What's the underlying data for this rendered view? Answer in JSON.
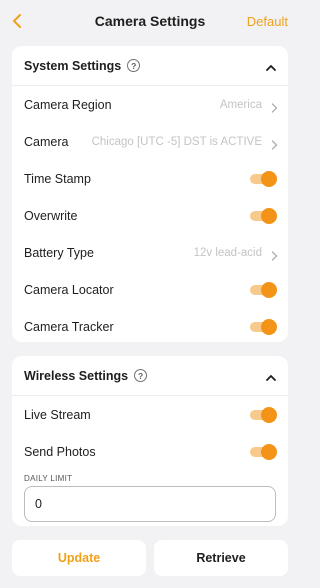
{
  "header": {
    "title": "Camera Settings",
    "action_label": "Default",
    "back_icon": "chevron-left-icon",
    "accent_color": "#f0a11a"
  },
  "system": {
    "title": "System Settings",
    "help_icon": "question-circle-icon",
    "rows": [
      {
        "label": "Camera Region",
        "value": "America",
        "kind": "select"
      },
      {
        "label": "Camera",
        "value": "Chicago [UTC -5] DST is ACTIVE",
        "kind": "select"
      },
      {
        "label": "Time Stamp",
        "on": true,
        "kind": "toggle"
      },
      {
        "label": "Overwrite",
        "on": true,
        "kind": "toggle"
      },
      {
        "label": "Battery Type",
        "value": "12v lead-acid",
        "kind": "select"
      },
      {
        "label": "Camera Locator",
        "on": true,
        "kind": "toggle"
      },
      {
        "label": "Camera Tracker",
        "on": true,
        "kind": "toggle"
      }
    ]
  },
  "wireless": {
    "title": "Wireless Settings",
    "help_icon": "question-circle-icon",
    "rows": [
      {
        "label": "Live Stream",
        "on": true,
        "kind": "toggle"
      },
      {
        "label": "Send Photos",
        "on": true,
        "kind": "toggle"
      }
    ],
    "daily_limit": {
      "label": "DAILY LIMIT",
      "value": "0"
    }
  },
  "footer": {
    "update_label": "Update",
    "retrieve_label": "Retrieve"
  },
  "toggle_color": "#f39418"
}
